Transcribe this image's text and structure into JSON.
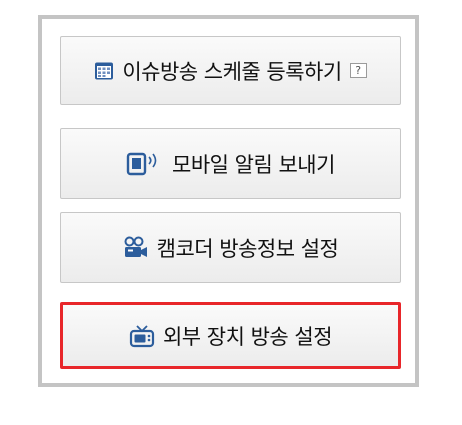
{
  "buttons": {
    "schedule": {
      "label": "이슈방송 스케줄 등록하기",
      "help": "?"
    },
    "mobile_alert": {
      "label": "모바일 알림 보내기"
    },
    "camcorder": {
      "label": "캠코더 방송정보 설정"
    },
    "external_device": {
      "label": "외부 장치 방송 설정"
    }
  },
  "icons": {
    "schedule": "calendar-icon",
    "mobile_alert": "mobile-signal-icon",
    "camcorder": "camcorder-icon",
    "external_device": "tv-icon"
  },
  "colors": {
    "panel_border": "#c4c4c4",
    "button_border": "#c7c7c7",
    "highlight_border": "#e8262a",
    "icon_blue": "#2c5d9c"
  }
}
